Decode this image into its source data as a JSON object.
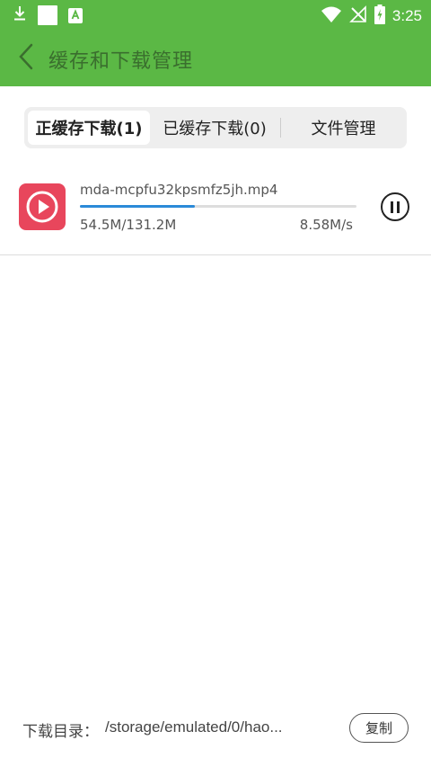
{
  "status_bar": {
    "time": "3:25",
    "icons": [
      "download-icon",
      "square-notification-icon",
      "app-a-icon",
      "wifi-icon",
      "no-signal-icon",
      "battery-charging-icon"
    ]
  },
  "header": {
    "title": "缓存和下载管理",
    "back_icon": "chevron-left-icon"
  },
  "tabs": [
    {
      "label": "正缓存下载(1)",
      "active": true
    },
    {
      "label": "已缓存下载(0)",
      "active": false
    },
    {
      "label": "文件管理",
      "active": false
    }
  ],
  "downloads": [
    {
      "filename": "mda-mcpfu32kpsmfz5jh.mp4",
      "progress": "54.5M/131.2M",
      "progress_fraction": 0.415,
      "speed": "8.58M/s",
      "icon": "video-play-icon",
      "action_icon": "pause-icon"
    }
  ],
  "footer": {
    "label": "下载目录：",
    "path": "/storage/emulated/0/hao...",
    "copy_label": "复制"
  },
  "colors": {
    "header_bg": "#5bb845",
    "title_text": "#3a6e2e",
    "video_icon_bg": "#e8465c",
    "progress": "#2b8ad8"
  }
}
